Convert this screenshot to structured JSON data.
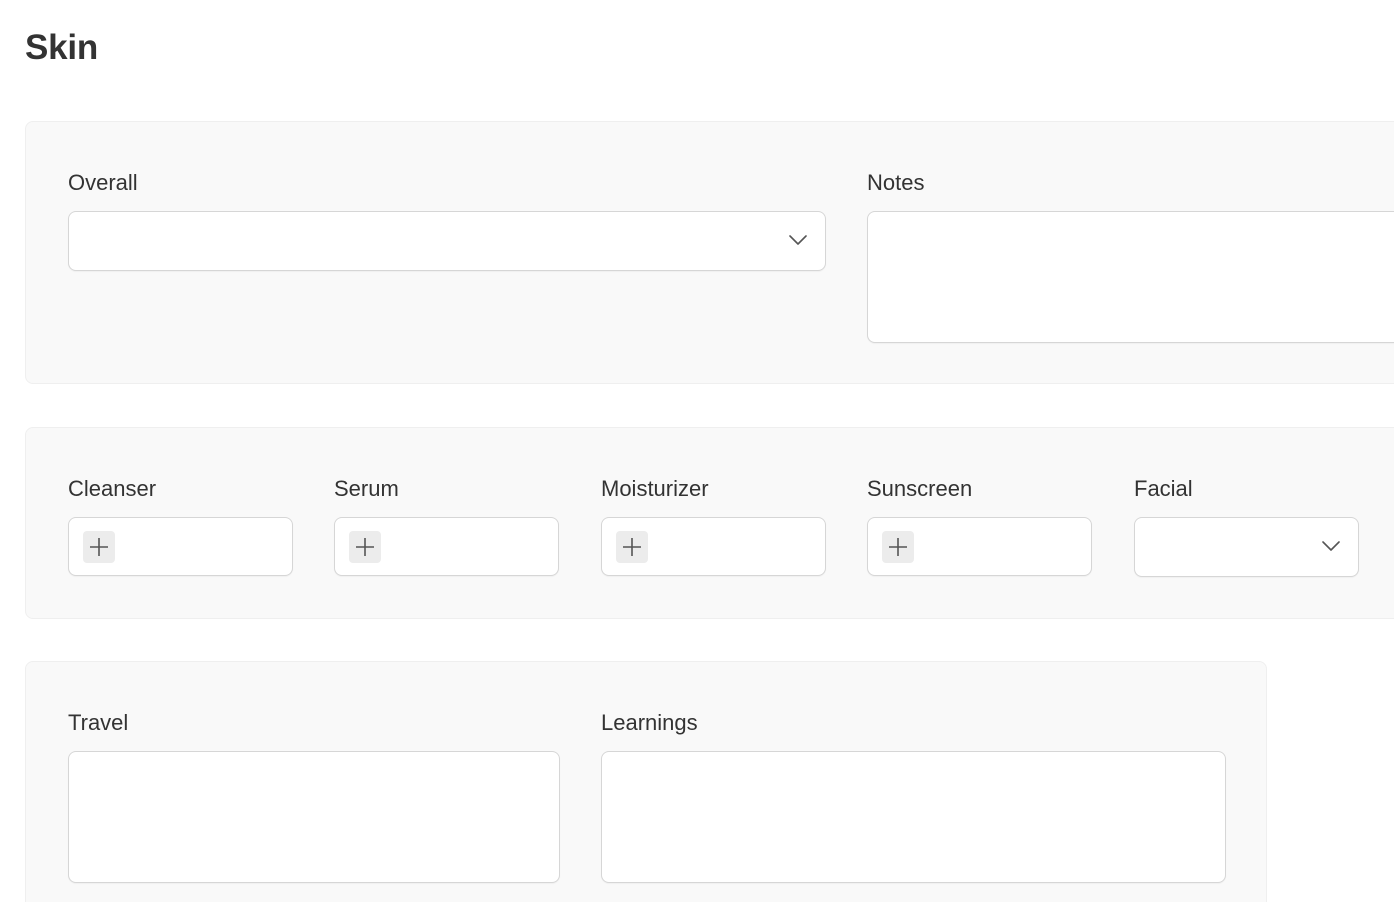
{
  "page": {
    "title": "Skin"
  },
  "sections": [
    {
      "fields": [
        {
          "label": "Overall",
          "type": "select",
          "value": ""
        },
        {
          "label": "Notes",
          "type": "textarea",
          "value": ""
        }
      ]
    },
    {
      "fields": [
        {
          "label": "Cleanser",
          "type": "multi-add"
        },
        {
          "label": "Serum",
          "type": "multi-add"
        },
        {
          "label": "Moisturizer",
          "type": "multi-add"
        },
        {
          "label": "Sunscreen",
          "type": "multi-add"
        },
        {
          "label": "Facial",
          "type": "select",
          "value": ""
        }
      ]
    },
    {
      "fields": [
        {
          "label": "Travel",
          "type": "textarea",
          "value": ""
        },
        {
          "label": "Learnings",
          "type": "textarea",
          "value": ""
        }
      ]
    }
  ],
  "icons": {
    "dropdown": "chevron-down-icon",
    "add": "plus-icon"
  },
  "colors": {
    "section_bg": "#f9f9f9",
    "control_border": "#d6d6d6",
    "add_button_bg": "#ececec",
    "text": "#333333"
  }
}
